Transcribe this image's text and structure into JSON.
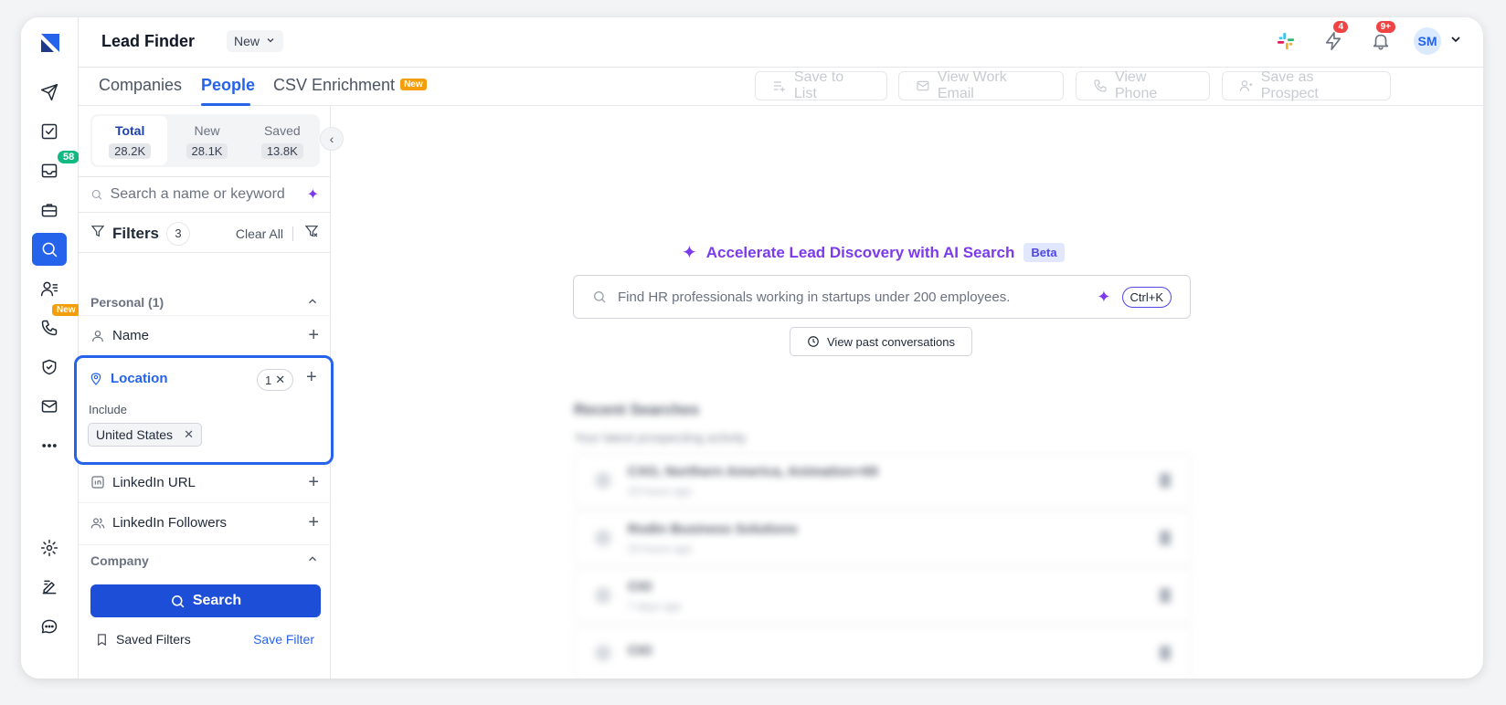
{
  "app": {
    "title": "Lead Finder",
    "title_chip": "New"
  },
  "rail": {
    "inbox_badge": "58",
    "calls_new_tag": "New",
    "icons": [
      "send-icon",
      "tasks-icon",
      "inbox-icon",
      "briefcase-icon",
      "search-icon",
      "contacts-icon",
      "phone-icon",
      "shield-icon",
      "mail-icon",
      "more-icon",
      "settings-icon",
      "feedback-icon",
      "chat-icon"
    ]
  },
  "top": {
    "lightning_badge": "4",
    "bell_badge": "9+",
    "avatar_initials": "SM"
  },
  "tabs": {
    "companies": "Companies",
    "people": "People",
    "csv": "CSV Enrichment",
    "csv_tag": "New"
  },
  "actions": {
    "save_to_list": "Save to List",
    "view_work_email": "View Work Email",
    "view_phone": "View Phone",
    "save_as_prospect": "Save as Prospect"
  },
  "stats": [
    {
      "label": "Total",
      "value": "28.2K"
    },
    {
      "label": "New",
      "value": "28.1K"
    },
    {
      "label": "Saved",
      "value": "13.8K"
    }
  ],
  "panel_search": {
    "placeholder": "Search a name or keyword"
  },
  "filters": {
    "title": "Filters",
    "count": "3",
    "clear_all": "Clear All",
    "personal_section": "Personal (1)",
    "name_row": "Name",
    "location": {
      "label": "Location",
      "count": "1",
      "include_label": "Include",
      "chip": "United States"
    },
    "linkedin_url": "LinkedIn URL",
    "linkedin_followers": "LinkedIn Followers",
    "company_section": "Company"
  },
  "panel_bottom": {
    "search_button": "Search",
    "saved_filters": "Saved Filters",
    "save_filter": "Save Filter"
  },
  "ai": {
    "title": "Accelerate Lead Discovery with AI Search",
    "beta": "Beta",
    "placeholder": "Find HR professionals working in startups under 200 employees.",
    "shortcut": "Ctrl+K",
    "past_conversations": "View past conversations"
  },
  "recent": {
    "title": "Recent Searches",
    "subtitle": "Your latest prospecting activity",
    "items": [
      {
        "name": "CXO, Northern America, Animation+69",
        "time": "23 hours ago"
      },
      {
        "name": "Rodin Business Solutions",
        "time": "23 hours ago"
      },
      {
        "name": "CIO",
        "time": "7 days ago"
      },
      {
        "name": "CIO",
        "time": ""
      }
    ]
  },
  "colors": {
    "primary": "#2563eb",
    "search_button": "#1d4ed8",
    "ai_accent": "#7c3aed",
    "new_tag": "#f59e0b",
    "inbox_badge": "#10b981",
    "alert_badge": "#ef4444"
  }
}
